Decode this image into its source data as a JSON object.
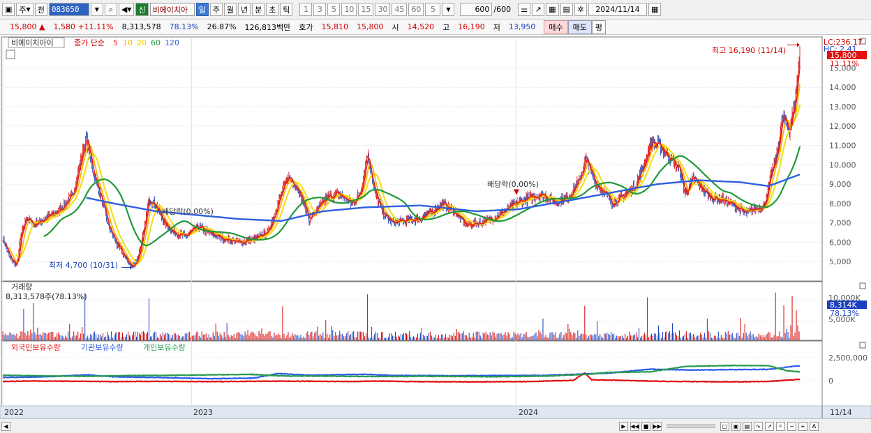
{
  "toolbar": {
    "period": "주",
    "prev_label": "전",
    "code": "083650",
    "new_badge": "신",
    "name": "비에이치아",
    "intervals": [
      "일",
      "주",
      "월",
      "년",
      "분",
      "초",
      "틱"
    ],
    "active_interval": "일",
    "multipliers": [
      "1",
      "3",
      "5",
      "10",
      "15",
      "30",
      "45",
      "60"
    ],
    "count_select": "5",
    "view_count": "600",
    "total_count": "/600",
    "date": "2024/11/14"
  },
  "quote": {
    "price": "15,800",
    "change_arrow": "▲",
    "change": "1,580",
    "change_pct": "+11.11%",
    "volume": "8,313,578",
    "volume_ratio": "78.13%",
    "turnover": "26.87%",
    "amount": "126,813백만",
    "bid_label": "호가",
    "bid1": "15,810",
    "bid2": "15,800",
    "open_label": "시",
    "open": "14,520",
    "high_label": "고",
    "high": "16,190",
    "low_label": "저",
    "low": "13,950",
    "buy_label": "매수",
    "sell_label": "매도",
    "avg_label": "평"
  },
  "colors": {
    "up": "#d40000",
    "down": "#1a3fbf",
    "ma5": "#e0201c",
    "ma10": "#ffb400",
    "ma20": "#f0e020",
    "ma60": "#1f9a3a",
    "ma120": "#2e5fe0",
    "foreign": "#e01010",
    "institution": "#2a5ce8",
    "individual": "#2a9a50"
  },
  "chart_data": [
    {
      "type": "line",
      "title": "",
      "legend_stock": "비에이치아이",
      "legend_label": "종가 단순",
      "ma_periods": [
        "5",
        "10",
        "20",
        "60",
        "120"
      ],
      "ylim": [
        4000,
        16600
      ],
      "yticks": [
        "5,000",
        "6,000",
        "7,000",
        "8,000",
        "9,000",
        "10,000",
        "11,000",
        "12,000",
        "13,000",
        "14,000",
        "15,000"
      ],
      "ytick_values": [
        5000,
        6000,
        7000,
        8000,
        9000,
        10000,
        11000,
        12000,
        13000,
        14000,
        15000
      ],
      "xlabels": [
        "2022",
        "2023",
        "2024"
      ],
      "current_price_label": "15,800",
      "current_pct_label": "11.11%",
      "lc_label": "LC:236.17",
      "hc_label": "HC: 2.41",
      "annotations": {
        "high": "최고 16,190 (11/14)",
        "low": "최저 4,700 (10/31)",
        "dividend1": "배당락(0.00%)",
        "dividend2": "배당락(0.00%)"
      },
      "price_keypoints": [
        [
          0,
          6200
        ],
        [
          10,
          5200
        ],
        [
          20,
          4800
        ],
        [
          26,
          6300
        ],
        [
          34,
          7300
        ],
        [
          44,
          6900
        ],
        [
          60,
          7200
        ],
        [
          80,
          7600
        ],
        [
          100,
          8400
        ],
        [
          112,
          10200
        ],
        [
          120,
          11400
        ],
        [
          130,
          9600
        ],
        [
          142,
          8200
        ],
        [
          152,
          6800
        ],
        [
          164,
          5900
        ],
        [
          176,
          5200
        ],
        [
          186,
          4700
        ],
        [
          194,
          5200
        ],
        [
          202,
          6400
        ],
        [
          210,
          8300
        ],
        [
          220,
          7900
        ],
        [
          232,
          7000
        ],
        [
          246,
          6500
        ],
        [
          262,
          6300
        ],
        [
          280,
          6800
        ],
        [
          296,
          6500
        ],
        [
          316,
          6200
        ],
        [
          340,
          6000
        ],
        [
          366,
          6200
        ],
        [
          382,
          6600
        ],
        [
          396,
          8100
        ],
        [
          410,
          9400
        ],
        [
          424,
          8800
        ],
        [
          440,
          7200
        ],
        [
          452,
          7700
        ],
        [
          466,
          8300
        ],
        [
          482,
          8500
        ],
        [
          502,
          8000
        ],
        [
          514,
          8600
        ],
        [
          524,
          10600
        ],
        [
          534,
          8600
        ],
        [
          546,
          7500
        ],
        [
          560,
          7000
        ],
        [
          576,
          7100
        ],
        [
          598,
          7200
        ],
        [
          618,
          7600
        ],
        [
          632,
          8000
        ],
        [
          648,
          7600
        ],
        [
          666,
          6900
        ],
        [
          686,
          7000
        ],
        [
          708,
          7300
        ],
        [
          724,
          7700
        ],
        [
          742,
          8100
        ],
        [
          758,
          8300
        ],
        [
          774,
          8500
        ],
        [
          792,
          8100
        ],
        [
          812,
          8300
        ],
        [
          828,
          9200
        ],
        [
          838,
          10300
        ],
        [
          850,
          9100
        ],
        [
          862,
          8700
        ],
        [
          876,
          8000
        ],
        [
          892,
          8400
        ],
        [
          908,
          8900
        ],
        [
          920,
          9900
        ],
        [
          932,
          11200
        ],
        [
          946,
          10900
        ],
        [
          960,
          10300
        ],
        [
          972,
          9800
        ],
        [
          980,
          8500
        ],
        [
          992,
          9300
        ],
        [
          1004,
          8800
        ],
        [
          1018,
          8300
        ],
        [
          1034,
          8200
        ],
        [
          1052,
          7900
        ],
        [
          1066,
          7500
        ],
        [
          1080,
          7700
        ],
        [
          1094,
          7900
        ],
        [
          1104,
          9500
        ],
        [
          1112,
          10500
        ],
        [
          1120,
          12500
        ],
        [
          1130,
          11800
        ],
        [
          1138,
          13200
        ],
        [
          1145,
          15800
        ]
      ],
      "price_ma120": [
        [
          0,
          null
        ],
        [
          120,
          8300
        ],
        [
          160,
          8000
        ],
        [
          220,
          7600
        ],
        [
          280,
          7400
        ],
        [
          340,
          7200
        ],
        [
          400,
          7100
        ],
        [
          460,
          7600
        ],
        [
          520,
          7800
        ],
        [
          600,
          7900
        ],
        [
          680,
          7600
        ],
        [
          740,
          7700
        ],
        [
          820,
          8200
        ],
        [
          880,
          8600
        ],
        [
          940,
          9000
        ],
        [
          1000,
          9200
        ],
        [
          1060,
          9100
        ],
        [
          1100,
          8900
        ],
        [
          1145,
          9500
        ]
      ]
    },
    {
      "type": "bar",
      "title": "",
      "label": "거래량",
      "value_label": "8,313,578주(78.13%)",
      "yticks": [
        "10,000K",
        "5,000K"
      ],
      "current_label": "8,314K",
      "current_pct_label": "78.13%",
      "spike_indices": [
        30,
        44,
        118,
        210,
        402,
        524,
        836,
        926,
        1110,
        1122,
        1134,
        1140
      ]
    },
    {
      "type": "line",
      "title": "",
      "series": [
        {
          "name": "외국인보유수량",
          "values": [
            [
              0,
              -80
            ],
            [
              40,
              -30
            ],
            [
              100,
              -60
            ],
            [
              160,
              -90
            ],
            [
              220,
              -70
            ],
            [
              300,
              -100
            ],
            [
              360,
              -60
            ],
            [
              420,
              -50
            ],
            [
              500,
              -90
            ],
            [
              540,
              -40
            ],
            [
              600,
              -110
            ],
            [
              680,
              -130
            ],
            [
              760,
              -90
            ],
            [
              820,
              50
            ],
            [
              836,
              850
            ],
            [
              846,
              100
            ],
            [
              900,
              20
            ],
            [
              940,
              -60
            ],
            [
              1000,
              -100
            ],
            [
              1060,
              -120
            ],
            [
              1100,
              -80
            ],
            [
              1145,
              150
            ]
          ]
        },
        {
          "name": "기관보유수량",
          "values": [
            [
              0,
              350
            ],
            [
              60,
              420
            ],
            [
              120,
              640
            ],
            [
              160,
              420
            ],
            [
              220,
              350
            ],
            [
              300,
              220
            ],
            [
              360,
              280
            ],
            [
              396,
              780
            ],
            [
              440,
              600
            ],
            [
              520,
              700
            ],
            [
              560,
              580
            ],
            [
              640,
              540
            ],
            [
              700,
              560
            ],
            [
              780,
              580
            ],
            [
              830,
              720
            ],
            [
              870,
              820
            ],
            [
              930,
              1250
            ],
            [
              990,
              1160
            ],
            [
              1040,
              1200
            ],
            [
              1100,
              1230
            ],
            [
              1130,
              1500
            ],
            [
              1145,
              1620
            ]
          ]
        },
        {
          "name": "개인보유수량",
          "values": [
            [
              0,
              600
            ],
            [
              60,
              520
            ],
            [
              120,
              480
            ],
            [
              180,
              560
            ],
            [
              240,
              580
            ],
            [
              300,
              640
            ],
            [
              360,
              680
            ],
            [
              400,
              520
            ],
            [
              460,
              500
            ],
            [
              540,
              450
            ],
            [
              620,
              480
            ],
            [
              700,
              430
            ],
            [
              780,
              500
            ],
            [
              840,
              700
            ],
            [
              870,
              900
            ],
            [
              930,
              960
            ],
            [
              980,
              1550
            ],
            [
              1040,
              1650
            ],
            [
              1100,
              1650
            ],
            [
              1125,
              1100
            ],
            [
              1145,
              960
            ]
          ]
        }
      ],
      "yticks": [
        "2,500,000",
        "0"
      ],
      "x_end_label": "11/14"
    }
  ]
}
